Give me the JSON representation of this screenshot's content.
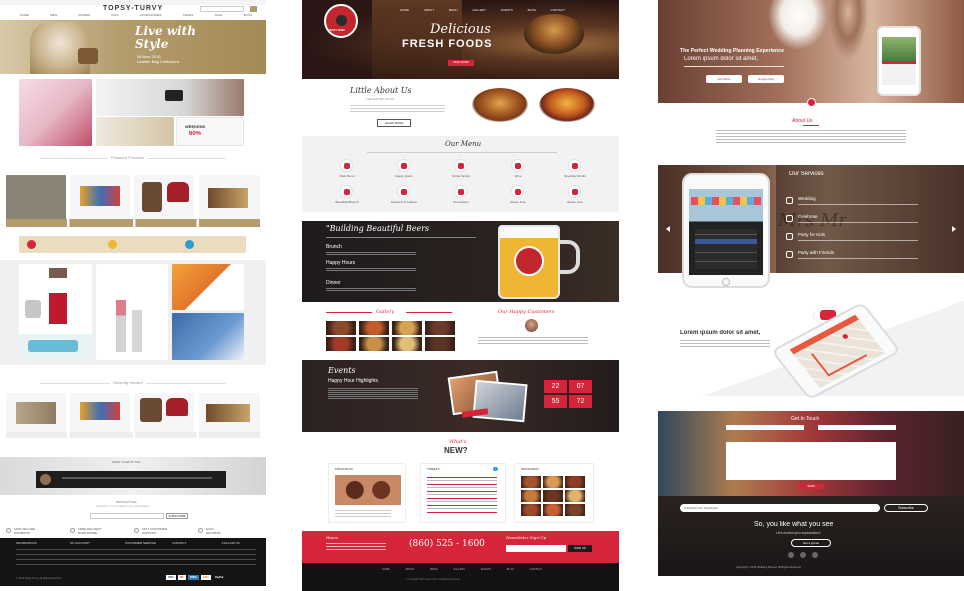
{
  "colors": {
    "gold": "#b49c6d",
    "red": "#d6253b",
    "dark": "#1e1b1b",
    "footer": "#121212",
    "light": "#f2f2f2"
  },
  "store": {
    "brand": "TOPSY-TURVY",
    "nav": [
      "HOME",
      "MEN",
      "WOMEN",
      "KIDS",
      "ACCESSORIES",
      "SHOES",
      "SALE",
      "BLOG"
    ],
    "hero": {
      "title1": "Live with",
      "title2": "Style",
      "sub1": "All New 2016",
      "sub2": "Leather Bag Collections"
    },
    "promo": {
      "weekend": "WEEKEND",
      "off": "60%"
    },
    "featured": "Featured Products",
    "recently": "Recently Viewed",
    "newsletter": "NEWSLETTER",
    "subscribe": "SUBSCRIBE",
    "newsletter_note": "Subscribe to our newsletter to get latest updates",
    "testimonial": "WHAT CLIENTS SAY",
    "services": [
      {
        "t1": "100% SECURE",
        "t2": "PAYMENTS"
      },
      {
        "t1": "FREE DELIVERY",
        "t2": "WORLDWIDE"
      },
      {
        "t1": "24X7 CUSTOMER",
        "t2": "SUPPORT"
      },
      {
        "t1": "EASY",
        "t2": "RETURNS"
      }
    ],
    "footer_heads": [
      "INFORMATION",
      "MY ACCOUNT",
      "CUSTOMER SERVICE",
      "CONTACT",
      "FOLLOW US"
    ],
    "copyright": "© 2016 Topsy-Turvy. All Rights Reserved",
    "payments": [
      "VISA",
      "MC",
      "AMEX",
      "DISC",
      "PayPal"
    ]
  },
  "restaurant": {
    "logo": "CRAZY SUBS",
    "nav": [
      "HOME",
      "ABOUT",
      "MENU",
      "GALLERY",
      "EVENTS",
      "BLOG",
      "CONTACT"
    ],
    "hero": {
      "t1": "Delicious",
      "t2": "FRESH FOODS",
      "cta": "READ MORE"
    },
    "about": {
      "title": "Little About Us",
      "sub": "THE HISTORY OF US",
      "cta": "LEARN MORE"
    },
    "menu": {
      "title": "Our Menu",
      "items": [
        "Main Menu",
        "Happy Hours",
        "Drinks Spirits",
        "Wine",
        "Specialty Drinks",
        "Breakfast/Brunch",
        "Desserts & Coffees",
        "Promotions",
        "Gluten Free",
        "Gluten Free"
      ]
    },
    "beers": {
      "title": "\"Building Beautiful Beers",
      "items": [
        "Brunch",
        "Happy Hours",
        "Dinner"
      ]
    },
    "gallery": "Gallery",
    "customers": "Our Happy Customers",
    "events": {
      "title": "Events",
      "sub": "Happy Hour Highlights",
      "timer": [
        "22",
        "07",
        "55",
        "72"
      ]
    },
    "whats": {
      "t1": "What's",
      "t2": "NEW?",
      "cols": [
        "FROM BLOG",
        "TWEETS",
        "INSTAGRAM"
      ]
    },
    "footer": {
      "hours": "Hours",
      "phone": "(860) 525 - 1600",
      "newsletter": "Newsletter Sign-Up",
      "signup": "SIGN UP",
      "copyright": "© Copyright 2016 Crazy Subs. All Rights Reserved"
    }
  },
  "wedding": {
    "hero": {
      "title": "The Perfect Wedding Planning Experience",
      "sub": "Lorem ipsum dolor sit amet,",
      "app_store": "App Store",
      "google_play": "Google Play"
    },
    "about": "About Us",
    "services": {
      "title": "Our Services",
      "items": [
        "Wedding",
        "Celebrate",
        "Party for Kids",
        "Party with Friends"
      ],
      "script": "Mrs  Mr"
    },
    "feature": "Lorem ipsum dolor sit amet,",
    "touch": {
      "title": "Get In Touch",
      "send": "SEND"
    },
    "subscribe": {
      "placeholder": "Subscribe Our Newsletter",
      "button": "Subscribe"
    },
    "like": "So, you like what you see",
    "like_sub": "Let's exceed your expectations!",
    "cta": "Get a Quote",
    "copyright": "Copyright © 2016 Wedding Planner. All Rights Reserved"
  }
}
